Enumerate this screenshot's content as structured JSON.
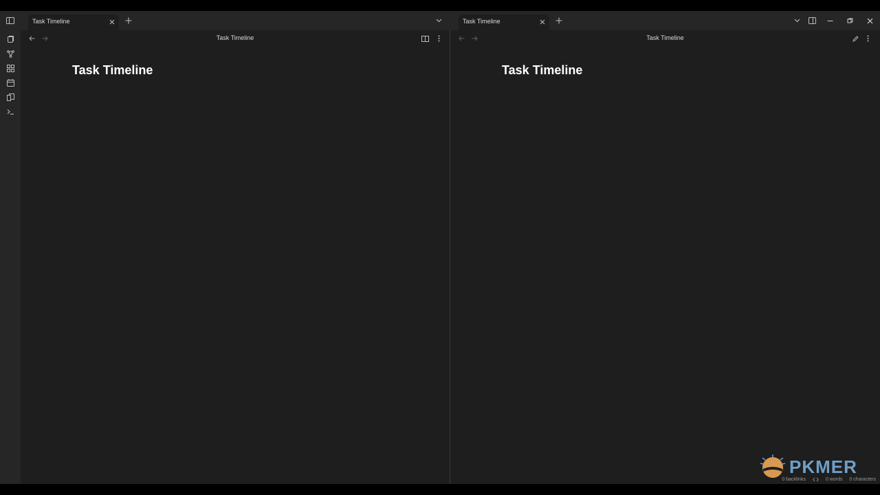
{
  "tabs": {
    "left": {
      "title": "Task Timeline"
    },
    "right": {
      "title": "Task Timeline"
    }
  },
  "panes": {
    "left": {
      "header_title": "Task Timeline",
      "note_title": "Task Timeline"
    },
    "right": {
      "header_title": "Task Timeline",
      "note_title": "Task Timeline"
    }
  },
  "ribbon": {
    "icons": [
      "files-icon",
      "graph-icon",
      "canvas-icon",
      "calendar-icon",
      "templates-icon",
      "terminal-icon"
    ]
  },
  "statusbar": {
    "backlinks": "0 backlinks",
    "words": "0 words",
    "characters": "0 characters"
  },
  "watermark": {
    "text": "PKMER"
  },
  "colors": {
    "background": "#1e1e1e",
    "tabstrip": "#262626",
    "text": "#dadada",
    "watermark_blue": "#6f9fc9",
    "watermark_orange": "#e0a35a"
  }
}
